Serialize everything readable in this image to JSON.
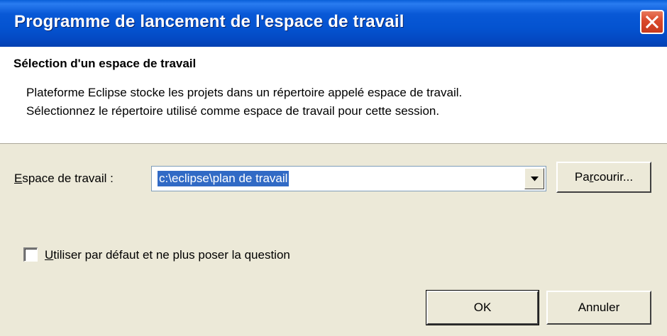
{
  "window": {
    "title": "Programme de lancement de l'espace de travail"
  },
  "header": {
    "title": "Sélection d'un espace de travail",
    "description_line1": "Plateforme Eclipse stocke les projets dans un répertoire appelé espace de travail.",
    "description_line2": "Sélectionnez le répertoire utilisé comme espace de travail pour cette session."
  },
  "workspace": {
    "label_mnemonic": "E",
    "label_rest": "space de travail :",
    "value": "c:\\eclipse\\plan de travail",
    "browse_before": "Pa",
    "browse_mnemonic": "r",
    "browse_after": "courir..."
  },
  "default_option": {
    "label_mnemonic": "U",
    "label_rest": "tiliser par défaut et ne plus poser la question",
    "checked": false
  },
  "buttons": {
    "ok": "OK",
    "cancel": "Annuler"
  },
  "icons": {
    "close": "close-icon",
    "dropdown": "chevron-down-icon"
  },
  "colors": {
    "titlebar": "#0453d0",
    "close_button": "#d9482a",
    "selection": "#316ac5",
    "dialog_bg": "#ece9d8"
  }
}
